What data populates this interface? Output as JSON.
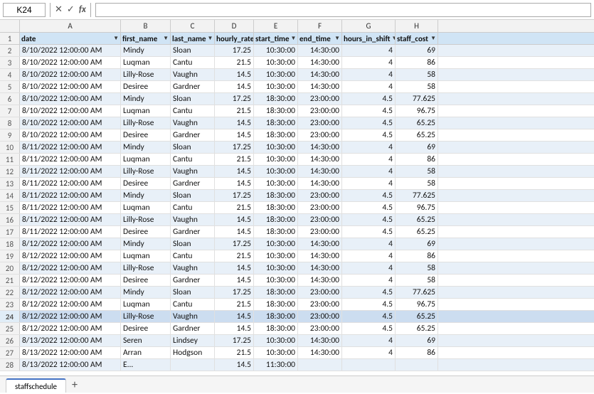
{
  "namebox": {
    "value": "K24"
  },
  "formulabar": {
    "value": ""
  },
  "formula_icons": [
    "✕",
    "✓",
    "fx"
  ],
  "columns": [
    {
      "id": "A",
      "label": "A",
      "width_class": "w-a"
    },
    {
      "id": "B",
      "label": "B",
      "width_class": "w-b"
    },
    {
      "id": "C",
      "label": "C",
      "width_class": "w-c"
    },
    {
      "id": "D",
      "label": "D",
      "width_class": "w-d"
    },
    {
      "id": "E",
      "label": "E",
      "width_class": "w-e"
    },
    {
      "id": "F",
      "label": "F",
      "width_class": "w-f"
    },
    {
      "id": "G",
      "label": "G",
      "width_class": "w-g"
    },
    {
      "id": "H",
      "label": "H",
      "width_class": "w-h"
    }
  ],
  "headers": [
    "date",
    "first_name",
    "last_name",
    "hourly_rate",
    "start_time",
    "end_time",
    "hours_in_shift",
    "staff_cost"
  ],
  "rows": [
    {
      "num": 2,
      "parity": "even",
      "cells": [
        "8/10/2022 12:00:00 AM",
        "Mindy",
        "Sloan",
        "17.25",
        "10:30:00",
        "14:30:00",
        "4",
        "69"
      ]
    },
    {
      "num": 3,
      "parity": "odd",
      "cells": [
        "8/10/2022 12:00:00 AM",
        "Luqman",
        "Cantu",
        "21.5",
        "10:30:00",
        "14:30:00",
        "4",
        "86"
      ]
    },
    {
      "num": 4,
      "parity": "even",
      "cells": [
        "8/10/2022 12:00:00 AM",
        "Lilly-Rose",
        "Vaughn",
        "14.5",
        "10:30:00",
        "14:30:00",
        "4",
        "58"
      ]
    },
    {
      "num": 5,
      "parity": "odd",
      "cells": [
        "8/10/2022 12:00:00 AM",
        "Desiree",
        "Gardner",
        "14.5",
        "10:30:00",
        "14:30:00",
        "4",
        "58"
      ]
    },
    {
      "num": 6,
      "parity": "even",
      "cells": [
        "8/10/2022 12:00:00 AM",
        "Mindy",
        "Sloan",
        "17.25",
        "18:30:00",
        "23:00:00",
        "4.5",
        "77.625"
      ]
    },
    {
      "num": 7,
      "parity": "odd",
      "cells": [
        "8/10/2022 12:00:00 AM",
        "Luqman",
        "Cantu",
        "21.5",
        "18:30:00",
        "23:00:00",
        "4.5",
        "96.75"
      ]
    },
    {
      "num": 8,
      "parity": "even",
      "cells": [
        "8/10/2022 12:00:00 AM",
        "Lilly-Rose",
        "Vaughn",
        "14.5",
        "18:30:00",
        "23:00:00",
        "4.5",
        "65.25"
      ]
    },
    {
      "num": 9,
      "parity": "odd",
      "cells": [
        "8/10/2022 12:00:00 AM",
        "Desiree",
        "Gardner",
        "14.5",
        "18:30:00",
        "23:00:00",
        "4.5",
        "65.25"
      ]
    },
    {
      "num": 10,
      "parity": "even",
      "cells": [
        "8/11/2022 12:00:00 AM",
        "Mindy",
        "Sloan",
        "17.25",
        "10:30:00",
        "14:30:00",
        "4",
        "69"
      ]
    },
    {
      "num": 11,
      "parity": "odd",
      "cells": [
        "8/11/2022 12:00:00 AM",
        "Luqman",
        "Cantu",
        "21.5",
        "10:30:00",
        "14:30:00",
        "4",
        "86"
      ]
    },
    {
      "num": 12,
      "parity": "even",
      "cells": [
        "8/11/2022 12:00:00 AM",
        "Lilly-Rose",
        "Vaughn",
        "14.5",
        "10:30:00",
        "14:30:00",
        "4",
        "58"
      ]
    },
    {
      "num": 13,
      "parity": "odd",
      "cells": [
        "8/11/2022 12:00:00 AM",
        "Desiree",
        "Gardner",
        "14.5",
        "10:30:00",
        "14:30:00",
        "4",
        "58"
      ]
    },
    {
      "num": 14,
      "parity": "even",
      "cells": [
        "8/11/2022 12:00:00 AM",
        "Mindy",
        "Sloan",
        "17.25",
        "18:30:00",
        "23:00:00",
        "4.5",
        "77.625"
      ]
    },
    {
      "num": 15,
      "parity": "odd",
      "cells": [
        "8/11/2022 12:00:00 AM",
        "Luqman",
        "Cantu",
        "21.5",
        "18:30:00",
        "23:00:00",
        "4.5",
        "96.75"
      ]
    },
    {
      "num": 16,
      "parity": "even",
      "cells": [
        "8/11/2022 12:00:00 AM",
        "Lilly-Rose",
        "Vaughn",
        "14.5",
        "18:30:00",
        "23:00:00",
        "4.5",
        "65.25"
      ]
    },
    {
      "num": 17,
      "parity": "odd",
      "cells": [
        "8/11/2022 12:00:00 AM",
        "Desiree",
        "Gardner",
        "14.5",
        "18:30:00",
        "23:00:00",
        "4.5",
        "65.25"
      ]
    },
    {
      "num": 18,
      "parity": "even",
      "cells": [
        "8/12/2022 12:00:00 AM",
        "Mindy",
        "Sloan",
        "17.25",
        "10:30:00",
        "14:30:00",
        "4",
        "69"
      ]
    },
    {
      "num": 19,
      "parity": "odd",
      "cells": [
        "8/12/2022 12:00:00 AM",
        "Luqman",
        "Cantu",
        "21.5",
        "10:30:00",
        "14:30:00",
        "4",
        "86"
      ]
    },
    {
      "num": 20,
      "parity": "even",
      "cells": [
        "8/12/2022 12:00:00 AM",
        "Lilly-Rose",
        "Vaughn",
        "14.5",
        "10:30:00",
        "14:30:00",
        "4",
        "58"
      ]
    },
    {
      "num": 21,
      "parity": "odd",
      "cells": [
        "8/12/2022 12:00:00 AM",
        "Desiree",
        "Gardner",
        "14.5",
        "10:30:00",
        "14:30:00",
        "4",
        "58"
      ]
    },
    {
      "num": 22,
      "parity": "even",
      "cells": [
        "8/12/2022 12:00:00 AM",
        "Mindy",
        "Sloan",
        "17.25",
        "18:30:00",
        "23:00:00",
        "4.5",
        "77.625"
      ]
    },
    {
      "num": 23,
      "parity": "odd",
      "cells": [
        "8/12/2022 12:00:00 AM",
        "Luqman",
        "Cantu",
        "21.5",
        "18:30:00",
        "23:00:00",
        "4.5",
        "96.75"
      ]
    },
    {
      "num": 24,
      "parity": "selected-row",
      "cells": [
        "8/12/2022 12:00:00 AM",
        "Lilly-Rose",
        "Vaughn",
        "14.5",
        "18:30:00",
        "23:00:00",
        "4.5",
        "65.25"
      ]
    },
    {
      "num": 25,
      "parity": "odd",
      "cells": [
        "8/12/2022 12:00:00 AM",
        "Desiree",
        "Gardner",
        "14.5",
        "18:30:00",
        "23:00:00",
        "4.5",
        "65.25"
      ]
    },
    {
      "num": 26,
      "parity": "even",
      "cells": [
        "8/13/2022 12:00:00 AM",
        "Seren",
        "Lindsey",
        "17.25",
        "10:30:00",
        "14:30:00",
        "4",
        "69"
      ]
    },
    {
      "num": 27,
      "parity": "odd",
      "cells": [
        "8/13/2022 12:00:00 AM",
        "Arran",
        "Hodgson",
        "21.5",
        "10:30:00",
        "14:30:00",
        "4",
        "86"
      ]
    },
    {
      "num": 28,
      "parity": "even",
      "cells": [
        "8/13/2022 12:00:00 AM",
        "E...",
        "",
        "14.5",
        "11:30:00",
        "",
        "",
        ""
      ]
    }
  ],
  "sheet_tab": {
    "label": "staffschedule"
  },
  "add_sheet_label": "+"
}
